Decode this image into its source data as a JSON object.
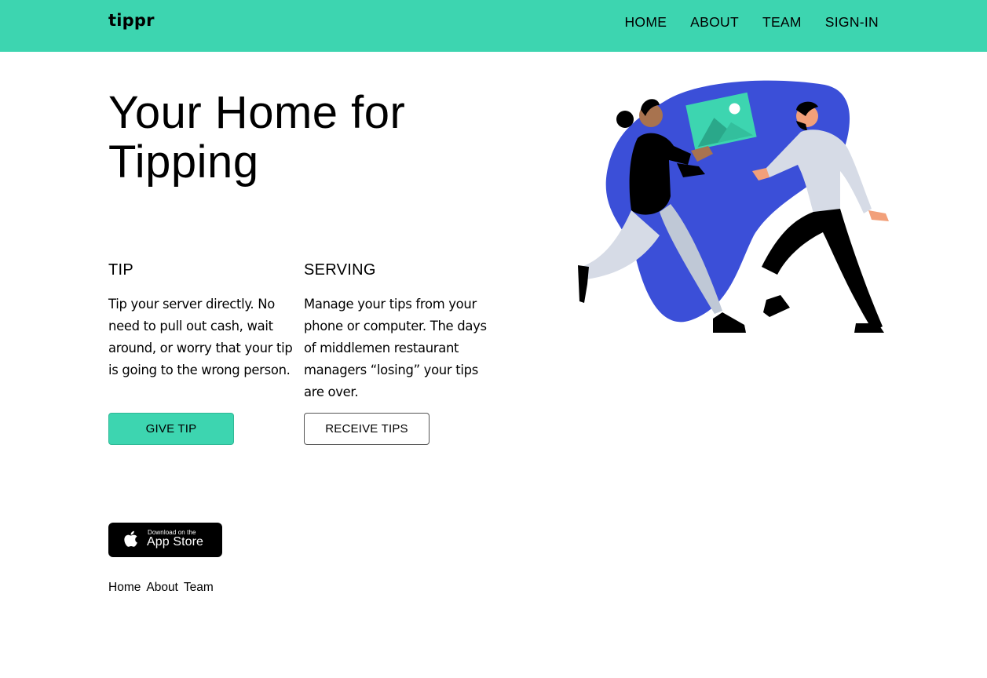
{
  "nav": {
    "brand": "tippr",
    "links": [
      "HOME",
      "ABOUT",
      "TEAM",
      "SIGN-IN"
    ]
  },
  "hero": {
    "title": "Your Home for Tipping"
  },
  "tip": {
    "heading": "TIP",
    "body": "Tip your server directly. No need to pull out cash, wait around, or worry that your tip is going to the wrong person.",
    "button": "GIVE TIP"
  },
  "serving": {
    "heading": "SERVING",
    "body": "Manage your tips from your phone or computer. The days of middlemen restaurant managers “losing” your tips are over.",
    "button": "RECEIVE TIPS"
  },
  "app_store": {
    "line1": "Download on the",
    "line2": "App Store"
  },
  "footer": {
    "links": [
      "Home",
      "About",
      "Team"
    ]
  },
  "colors": {
    "accent": "#3dd5b0",
    "illustration_blob": "#3b4fd8"
  }
}
